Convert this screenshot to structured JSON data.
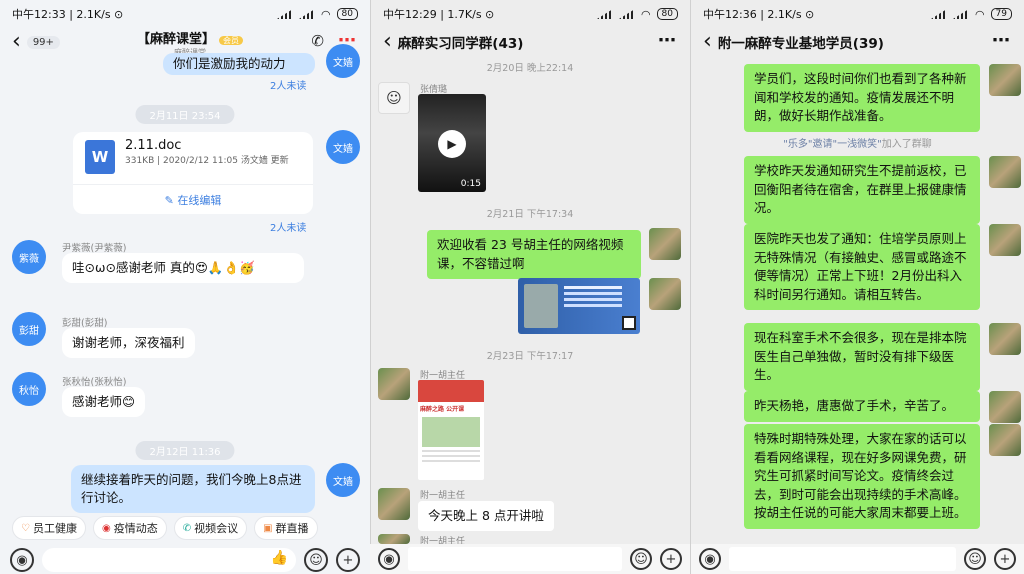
{
  "left": {
    "status": {
      "time": "中午12:33",
      "speed": "2.1K/s",
      "battery": "80"
    },
    "nav": {
      "unread_badge": "99+",
      "title": "【麻醉课堂】",
      "vip": "会员",
      "subtitle": "麻醉课堂"
    },
    "messages": {
      "m1": "你们是激励我的动力",
      "m1_unread": "2人未读",
      "time1": "2月11日 23:54",
      "file_name": "2.11.doc",
      "file_meta": "331KB | 2020/2/12 11:05 汤文嫱 更新",
      "file_edit": "在线编辑",
      "file_unread": "2人未读",
      "me_avatar": "文嫱",
      "u1_name": "尹紫薇(尹紫薇)",
      "u1_avatar": "紫薇",
      "u1_text": "哇⊙ω⊙感谢老师  真的😍🙏👌🥳",
      "u2_name": "彭甜(彭甜)",
      "u2_avatar": "彭甜",
      "u2_text": "谢谢老师，深夜福利",
      "u3_name": "张秋怡(张秋怡)",
      "u3_avatar": "秋怡",
      "u3_text": "感谢老师😊",
      "time2": "2月12日 11:36",
      "m2": "继续接着昨天的问题，我们今晚上8点进行讨论。"
    },
    "quick": [
      "员工健康",
      "疫情动态",
      "视频会议",
      "群直播"
    ]
  },
  "middle": {
    "status": {
      "time": "中午12:29",
      "speed": "1.7K/s",
      "battery": "80"
    },
    "title": "麻醉实习同学群(43)",
    "time1": "2月20日 晚上22:14",
    "sender1": "张倩璐",
    "video_duration": "0:15",
    "time2": "2月21日 下午17:34",
    "my_msg": "欢迎收看 23 号胡主任的网络视频课，不容错过啊",
    "time3": "2月23日 下午17:17",
    "sender2": "附一胡主任",
    "card_title": "麻醉之路 公开课",
    "sender3": "附一胡主任",
    "hu_msg": "今天晚上 8 点开讲啦",
    "sender4": "附一胡主任"
  },
  "right": {
    "status": {
      "time": "中午12:36",
      "speed": "2.1K/s",
      "battery": "79"
    },
    "title": "附一麻醉专业基地学员(39)",
    "b1": "学员们，这段时间你们也看到了各种新闻和学校发的通知。疫情发展还不明朗，做好长期作战准备。",
    "sys_a": "\"乐多\"邀请",
    "sys_b": "\"一浅微笑\"",
    "sys_c": "加入了群聊",
    "b2": "学校昨天发通知研究生不提前返校，已回衡阳者待在宿舍，在群里上报健康情况。",
    "b3": "医院昨天也发了通知：住培学员原则上无特殊情况（有接触史、感冒或路途不便等情况）正常上下班！2月份出科入科时间另行通知。请相互转告。",
    "b4": "现在科室手术不会很多，现在是排本院医生自己单独做，暂时没有排下级医生。",
    "b5": "昨天杨艳，唐惠做了手术，辛苦了。",
    "b6": "特殊时期特殊处理，大家在家的话可以看看网络课程，现在好多网课免费，研究生可抓紧时间写论文。疫情终会过去，到时可能会出现持续的手术高峰。按胡主任说的可能大家周末都要上班。"
  }
}
